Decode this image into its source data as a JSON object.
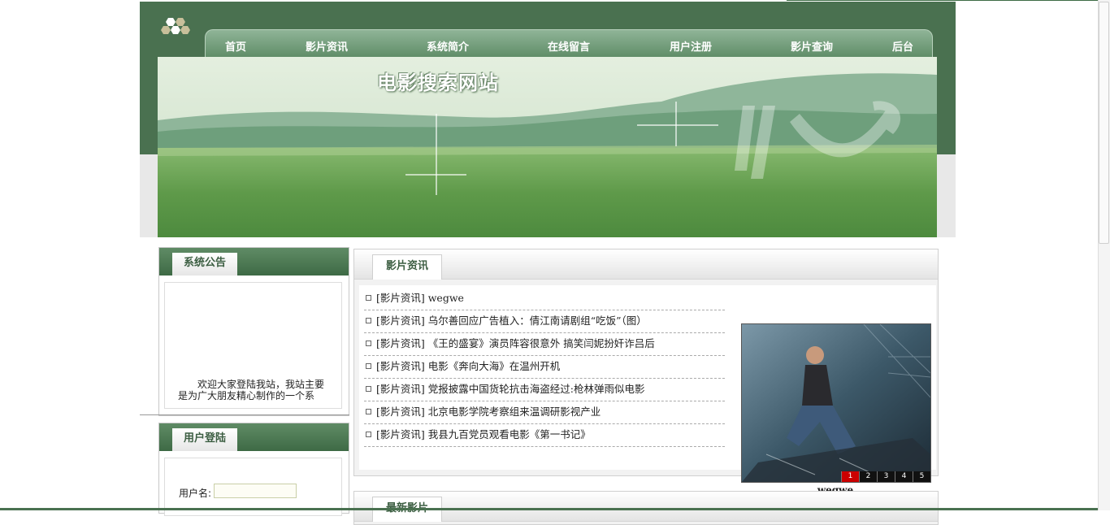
{
  "site": {
    "title": "电影搜索网站"
  },
  "nav": {
    "items": [
      "首页",
      "影片资讯",
      "系统简介",
      "在线留言",
      "用户注册",
      "影片查询",
      "后台"
    ]
  },
  "notice": {
    "title": "系统公告",
    "text_line1": "欢迎大家登陆我站，我站主要",
    "text_line2": "是为广大朋友精心制作的一个系"
  },
  "login": {
    "title": "用户登陆",
    "username_label": "用户名:",
    "username_value": ""
  },
  "news": {
    "title": "影片资讯",
    "items": [
      "[影片资讯] wegwe",
      "[影片资讯] 乌尔善回应广告植入：倩江南请剧组“吃饭”（图）",
      "[影片资讯] 《王的盛宴》演员阵容很意外 搞笑闫妮扮奸诈吕后",
      "[影片资讯] 电影《奔向大海》在温州开机",
      "[影片资讯] 党报披露中国货轮抗击海盗经过:枪林弹雨似电影",
      "[影片资讯] 北京电影学院考察组来温调研影视产业",
      "[影片资讯] 我县九百党员观看电影《第一书记》"
    ],
    "slideshow": {
      "caption": "wegwe",
      "pages": [
        "1",
        "2",
        "3",
        "4",
        "5"
      ],
      "active_page": "1"
    }
  },
  "latest": {
    "title": "最新影片"
  },
  "colors": {
    "header_green": "#4a7150",
    "accent_red": "#cc0000"
  }
}
